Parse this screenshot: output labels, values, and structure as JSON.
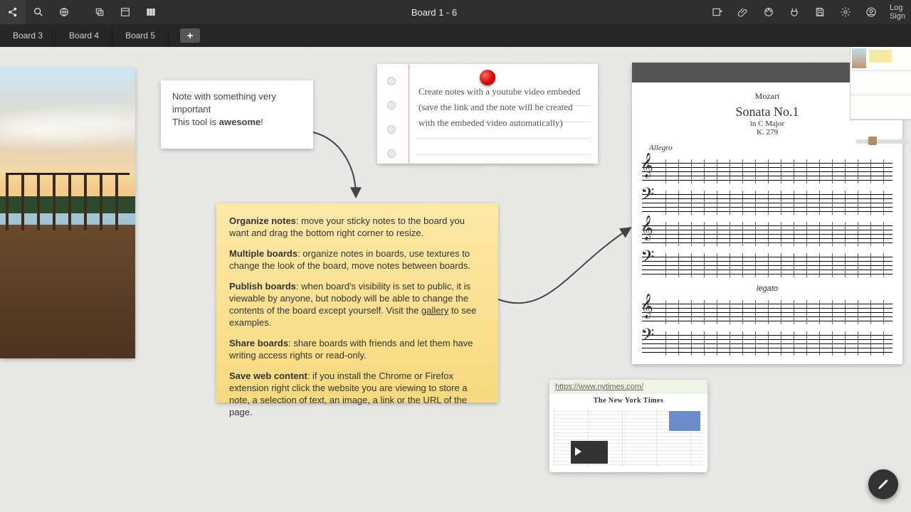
{
  "header": {
    "title": "Board 1 - 6",
    "auth_line1": "Log",
    "auth_line2": "Sign"
  },
  "tabs": [
    {
      "label": "Board 3"
    },
    {
      "label": "Board 4"
    },
    {
      "label": "Board 5"
    }
  ],
  "plain_note": {
    "line1": "Note with something very important",
    "line2_a": "This tool is ",
    "line2_b": "awesome",
    "line2_c": "!"
  },
  "lined_note": {
    "text": "Create notes with a youtube video embeded (save the link and the note will be created with the embeded video automatically)"
  },
  "sticky_note": {
    "p1_b": "Organize notes",
    "p1": ": move your sticky notes to the board you want and drag the bottom right corner to resize.",
    "p2_b": "Multiple boards",
    "p2": ": organize notes in boards, use textures to change the look of the board, move notes between boards.",
    "p3_b": "Publish boards",
    "p3a": ": when board's visibility is set to public, it is viewable by anyone, but nobody will be able to change the contents of the board except yourself. Visit the ",
    "p3_link": "gallery",
    "p3b": " to see examples.",
    "p4_b": "Share boards",
    "p4": ": share boards with friends and let them have writing access rights or read-only.",
    "p5_b": "Save web content",
    "p5": ": if you install the Chrome or Firefox extension right click the website you are viewing to store a note, a selection of text, an image, a link or the URL of the page."
  },
  "sheet_music": {
    "composer": "Mozart",
    "title": "Sonata No.1",
    "key": "in C Major",
    "k": "K. 279",
    "tempo": "Allegro",
    "dynamic": "legato"
  },
  "webclip": {
    "url": "https://www.nytimes.com/",
    "masthead": "The New York Times"
  }
}
